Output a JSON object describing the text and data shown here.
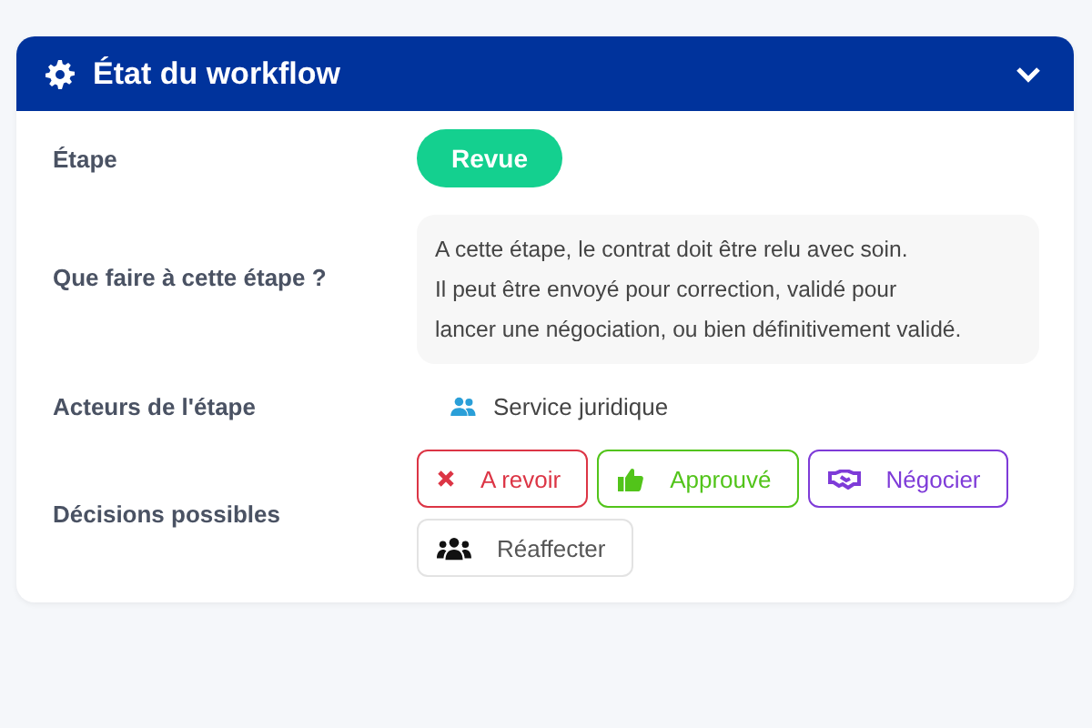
{
  "panel": {
    "title": "État du workflow",
    "expanded": true
  },
  "stage": {
    "label": "Étape",
    "value": "Revue"
  },
  "description": {
    "label": "Que faire à cette étape ?",
    "lines": [
      "A cette étape, le contrat doit être relu avec soin.",
      "Il peut être envoyé pour correction, validé pour",
      "lancer une négociation, ou bien définitivement validé."
    ]
  },
  "actors": {
    "label": "Acteurs de l'étape",
    "items": [
      "Service juridique"
    ]
  },
  "decisions": {
    "label": "Décisions possibles",
    "items": [
      {
        "label": "A revoir",
        "kind": "reject",
        "color": "#dc3545"
      },
      {
        "label": "Approuvé",
        "kind": "approve",
        "color": "#52c41a"
      },
      {
        "label": "Négocier",
        "kind": "negotiate",
        "color": "#7e3bd8"
      },
      {
        "label": "Réaffecter",
        "kind": "reassign",
        "color": "#555555"
      }
    ]
  }
}
